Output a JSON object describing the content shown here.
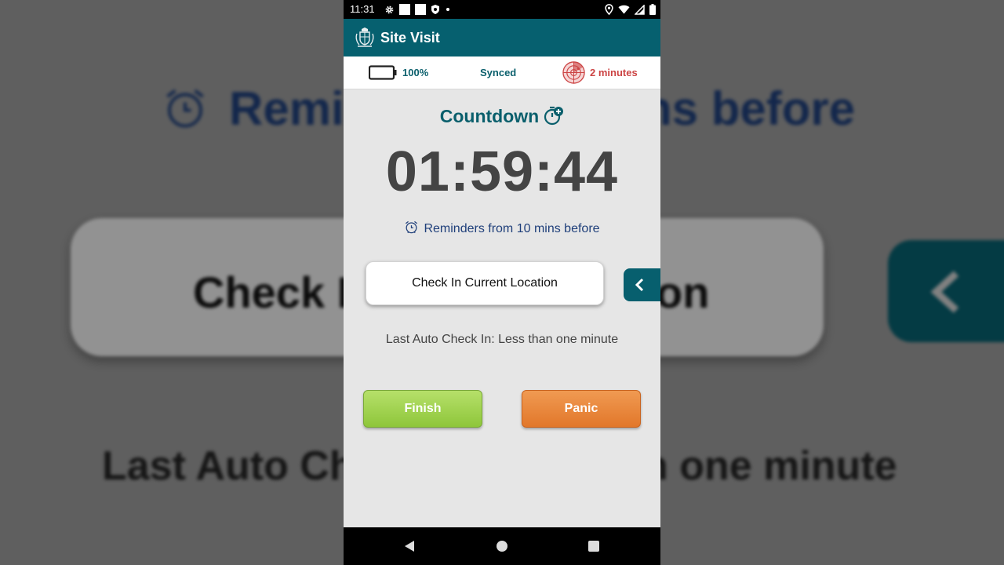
{
  "background": {
    "reminders_left": "Remin",
    "reminders_right": "ns before",
    "checkin_left": "Check I",
    "checkin_right": "on",
    "last_left": "Last Auto Ch",
    "last_right": "n one minute"
  },
  "status_bar": {
    "time": "11:31"
  },
  "app_bar": {
    "title": "Site Visit"
  },
  "info_bar": {
    "battery_level": "100%",
    "sync_status": "Synced",
    "radar_interval": "2 minutes"
  },
  "countdown": {
    "title": "Countdown",
    "timer": "01:59:44",
    "reminders": "Reminders from 10 mins before"
  },
  "actions": {
    "checkin_label": "Check In Current Location",
    "last_auto_checkin": "Last Auto Check In: Less than one minute",
    "finish_label": "Finish",
    "panic_label": "Panic"
  },
  "colors": {
    "primary": "#06606f",
    "accent_text": "#0a5f6c",
    "reminder_text": "#1f3f7a",
    "alert_red": "#cc4444",
    "finish_green": "#8ec63a",
    "panic_orange": "#e2772a"
  },
  "icons": {
    "settings": "gear-icon",
    "location": "location-pin-icon",
    "wifi": "wifi-icon",
    "signal": "cell-signal-icon",
    "battery": "battery-icon",
    "radar": "radar-icon",
    "timer_add": "timer-plus-icon",
    "alarm": "alarm-clock-icon",
    "back": "chevron-left-icon"
  }
}
